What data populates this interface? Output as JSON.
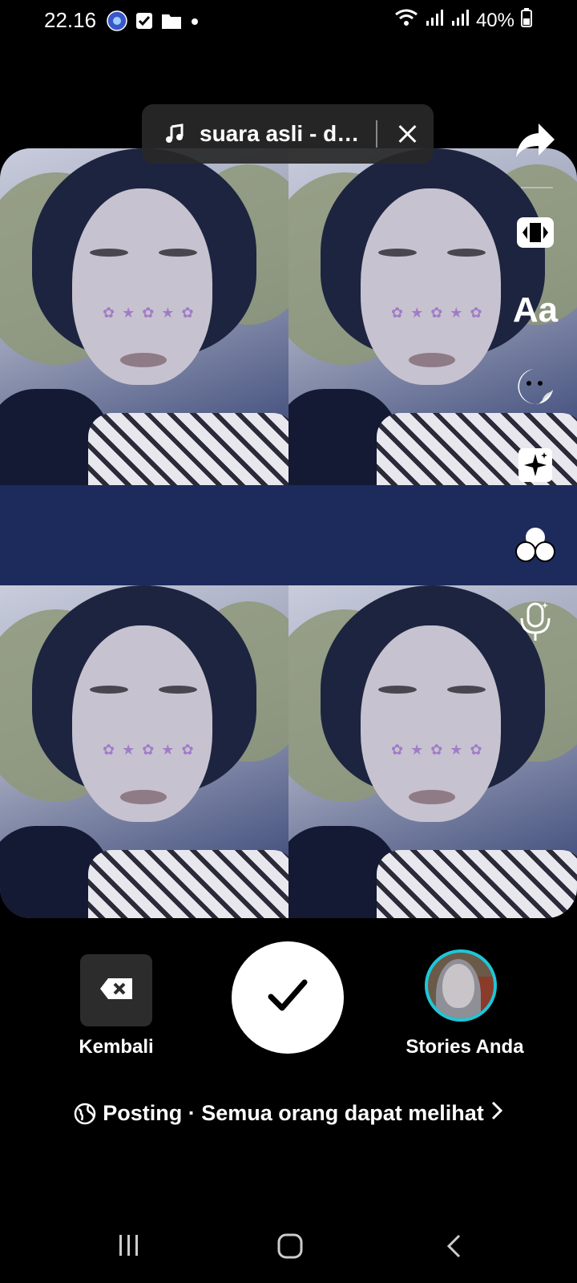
{
  "status_bar": {
    "time": "22.16",
    "battery": "40%",
    "icons_left": [
      "app-icon",
      "checkbox-icon",
      "folder-icon",
      "dot-icon"
    ],
    "icons_right": [
      "wifi-icon",
      "signal-icon",
      "signal-icon",
      "battery-icon"
    ]
  },
  "music": {
    "label": "suara asli - da...",
    "icon": "music-note-icon"
  },
  "sidebar": {
    "items": [
      {
        "name": "share",
        "icon": "share-arrow-icon"
      },
      {
        "name": "resize",
        "icon": "resize-icon"
      },
      {
        "name": "text",
        "label": "Aa"
      },
      {
        "name": "sticker",
        "icon": "sticker-icon"
      },
      {
        "name": "effects",
        "icon": "sparkle-icon"
      },
      {
        "name": "filters",
        "icon": "filters-icon"
      },
      {
        "name": "voice",
        "icon": "voice-effect-icon"
      }
    ]
  },
  "actions": {
    "back_label": "Kembali",
    "stories_label": "Stories Anda"
  },
  "post": {
    "text": "Posting · Semua orang dapat melihat"
  },
  "nav": {
    "icons": [
      "recent-apps-icon",
      "home-icon",
      "back-icon"
    ]
  },
  "colors": {
    "accent_ring": "#1fc6d8",
    "media_band": "#1d2a5c",
    "pill_bg": "#282828"
  }
}
